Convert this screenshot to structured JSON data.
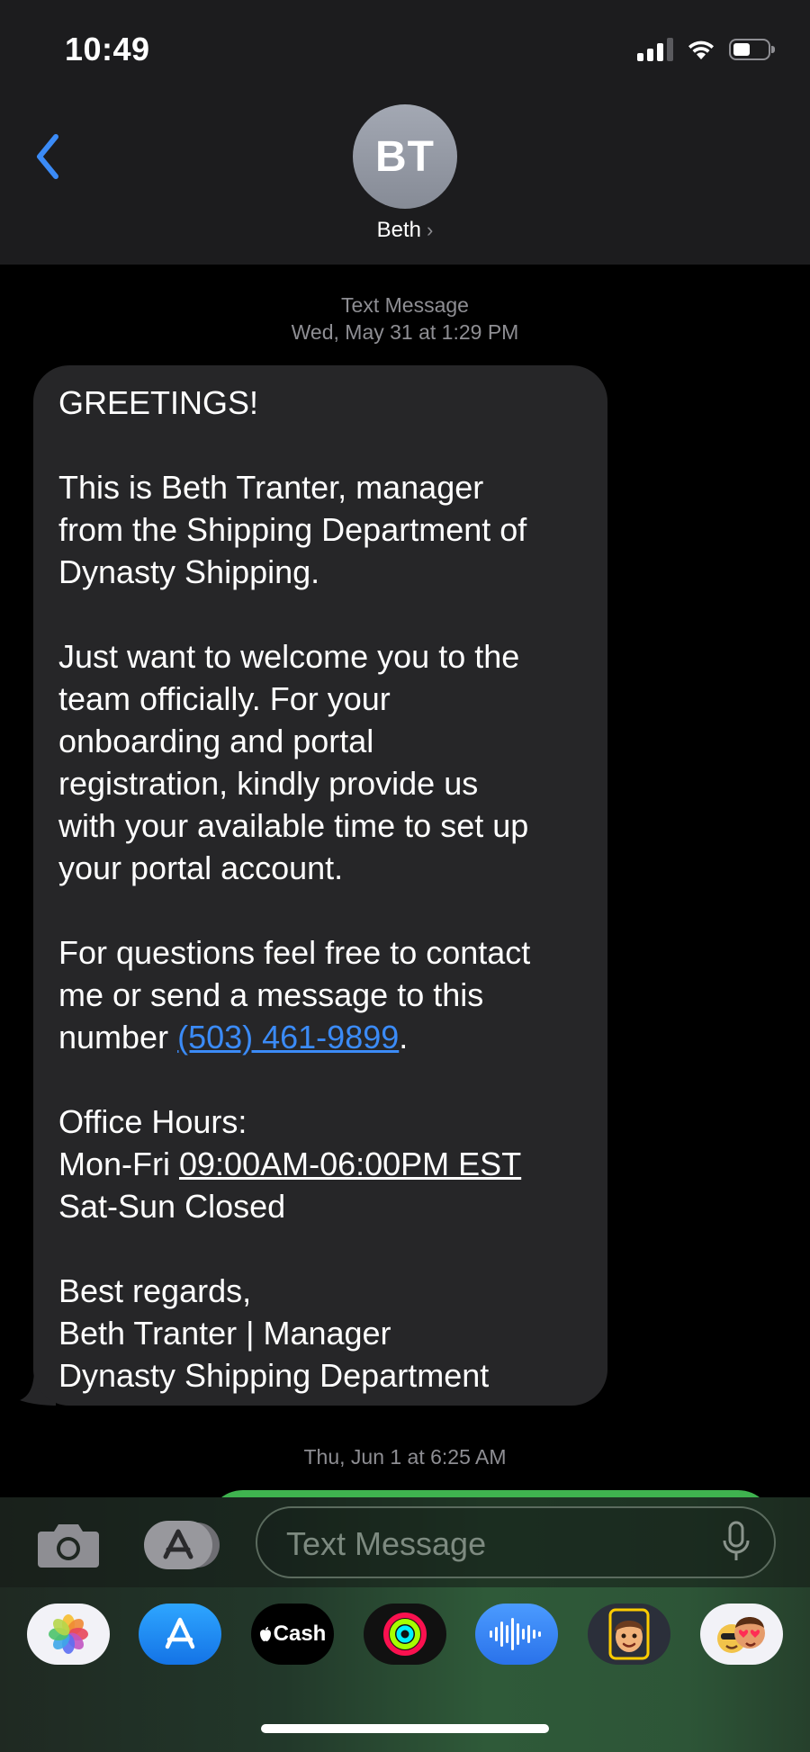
{
  "status_bar": {
    "time": "10:49"
  },
  "header": {
    "avatar_initials": "BT",
    "contact_name": "Beth",
    "chevron": "›"
  },
  "conversation": {
    "first_meta": {
      "service": "Text Message",
      "timestamp": "Wed, May 31 at 1:29 PM"
    },
    "message": {
      "line1": "GREETINGS!",
      "p2_l1": "This is Beth Tranter, manager",
      "p2_l2": "from the Shipping Department of",
      "p2_l3": "Dynasty Shipping.",
      "p3_l1": "Just want to welcome you to the",
      "p3_l2": "team officially. For your",
      "p3_l3": "onboarding and portal",
      "p3_l4": "registration, kindly provide us",
      "p3_l5": "with your available time to set up",
      "p3_l6": "your portal account.",
      "p4_l1": "For questions feel free to contact",
      "p4_l2": "me or send a message to this",
      "p4_l3_prefix": "number ",
      "phone": "(503) 461-9899",
      "p4_l3_suffix": ".",
      "p5_l1": "Office Hours:",
      "p5_l2_prefix": "Mon-Fri ",
      "p5_l2_hours": "09:00AM-06:00PM EST",
      "p5_l3": "Sat-Sun Closed",
      "p6_l1": "Best regards,",
      "p6_l2": "Beth Tranter | Manager",
      "p6_l3": "Dynasty Shipping Department"
    },
    "second_meta": {
      "timestamp": "Thu, Jun 1 at 6:25 AM"
    }
  },
  "composer": {
    "placeholder": "Text Message"
  },
  "app_tray": {
    "items": [
      {
        "name": "photos-app-icon"
      },
      {
        "name": "app-store-icon"
      },
      {
        "name": "apple-cash",
        "label": "Cash"
      },
      {
        "name": "fitness-activity-icon"
      },
      {
        "name": "audio-message-icon"
      },
      {
        "name": "memoji-icon"
      },
      {
        "name": "memoji-stickers-icon"
      }
    ]
  },
  "colors": {
    "accent_blue": "#3b8bf7",
    "bubble_gray": "#262628",
    "header_bg": "#1c1c1e",
    "imessage_green": "#3fb34f"
  }
}
